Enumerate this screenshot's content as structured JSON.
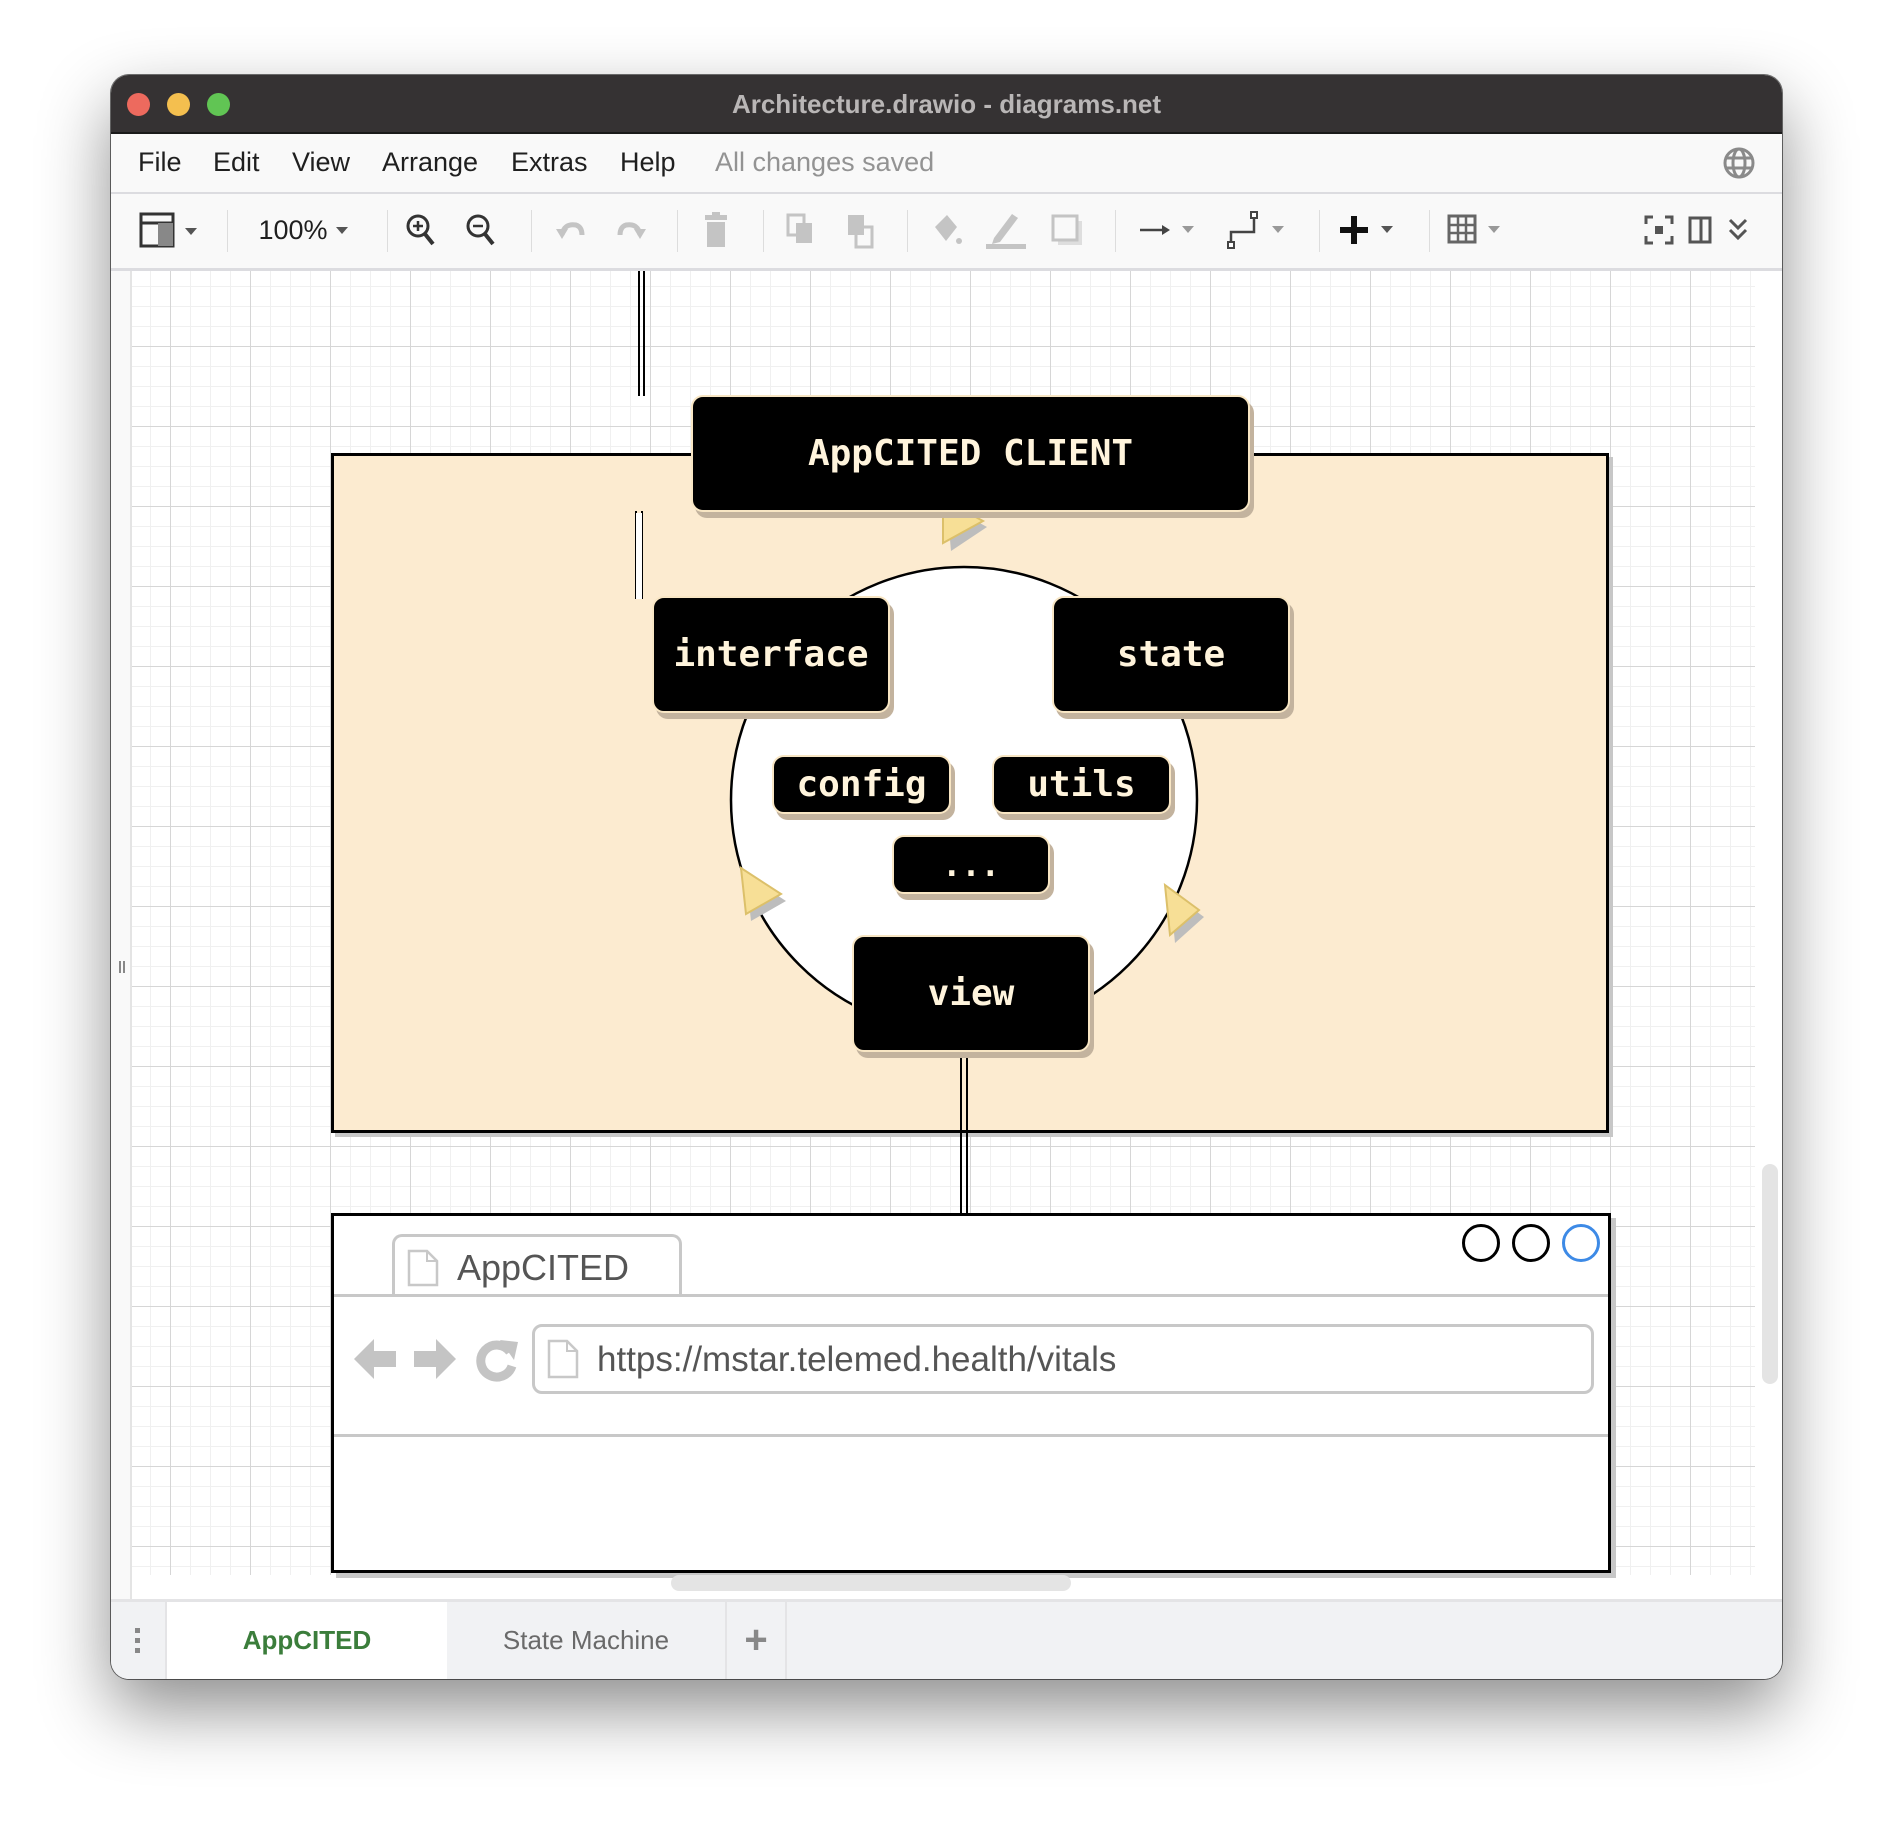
{
  "window": {
    "title": "Architecture.drawio - diagrams.net"
  },
  "menu": {
    "items": [
      "File",
      "Edit",
      "View",
      "Arrange",
      "Extras",
      "Help"
    ],
    "status": "All changes saved",
    "language_icon": "globe-icon"
  },
  "toolbar": {
    "zoom_level": "100%",
    "icons": [
      "format-panel-icon",
      "zoom-in-icon",
      "zoom-out-icon",
      "undo-icon",
      "redo-icon",
      "delete-icon",
      "to-front-icon",
      "to-back-icon",
      "fill-color-icon",
      "line-color-icon",
      "shadow-icon",
      "connection-arrow-icon",
      "waypoints-icon",
      "insert-plus-icon",
      "table-icon",
      "fullscreen-icon",
      "format-toggle-icon",
      "collapse-chevrons-icon"
    ]
  },
  "diagram": {
    "client_label": "AppCITED CLIENT",
    "nodes": {
      "interface": "interface",
      "state": "state",
      "config": "config",
      "utils": "utils",
      "more": "...",
      "view": "view"
    },
    "colors": {
      "container_fill": "#fcebd0",
      "node_fill": "#000000",
      "node_text": "#fff4dc",
      "arrow_fill": "#f6dc8e"
    },
    "browser": {
      "tab_title": "AppCITED",
      "url": "https://mstar.telemed.health/vitals"
    }
  },
  "pages": {
    "tabs": [
      {
        "label": "AppCITED",
        "active": true
      },
      {
        "label": "State Machine",
        "active": false
      }
    ],
    "add_label": "+"
  }
}
